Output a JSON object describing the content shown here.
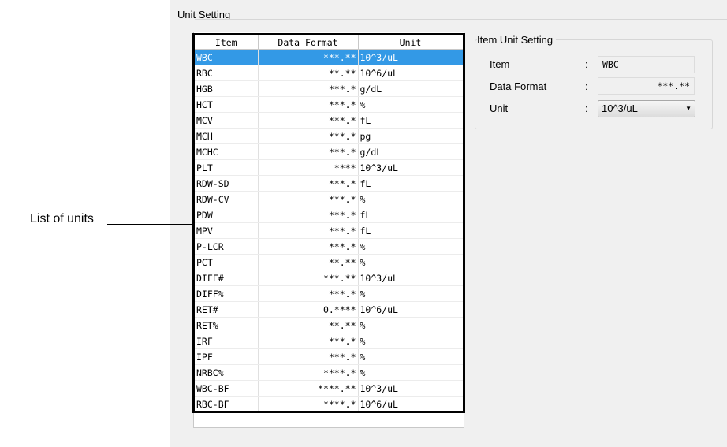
{
  "window": {
    "title": "Unit Setting"
  },
  "annotation": {
    "label": "List of units"
  },
  "list": {
    "columns": [
      "Item",
      "Data Format",
      "Unit"
    ],
    "rows": [
      [
        "WBC",
        "***.**",
        "10^3/uL"
      ],
      [
        "RBC",
        "**.**",
        "10^6/uL"
      ],
      [
        "HGB",
        "***.*",
        "g/dL"
      ],
      [
        "HCT",
        "***.*",
        "%"
      ],
      [
        "MCV",
        "***.*",
        "fL"
      ],
      [
        "MCH",
        "***.*",
        "pg"
      ],
      [
        "MCHC",
        "***.*",
        "g/dL"
      ],
      [
        "PLT",
        "****",
        "10^3/uL"
      ],
      [
        "RDW-SD",
        "***.*",
        "fL"
      ],
      [
        "RDW-CV",
        "***.*",
        "%"
      ],
      [
        "PDW",
        "***.*",
        "fL"
      ],
      [
        "MPV",
        "***.*",
        "fL"
      ],
      [
        "P-LCR",
        "***.*",
        "%"
      ],
      [
        "PCT",
        "**.**",
        "%"
      ],
      [
        "DIFF#",
        "***.**",
        "10^3/uL"
      ],
      [
        "DIFF%",
        "***.*",
        "%"
      ],
      [
        "RET#",
        "0.****",
        "10^6/uL"
      ],
      [
        "RET%",
        "**.**",
        "%"
      ],
      [
        "IRF",
        "***.*",
        "%"
      ],
      [
        "IPF",
        "***.*",
        "%"
      ],
      [
        "NRBC%",
        "****.*",
        "%"
      ],
      [
        "WBC-BF",
        "****.**",
        "10^3/uL"
      ],
      [
        "RBC-BF",
        "****.*",
        "10^6/uL"
      ]
    ],
    "selected_index": 0
  },
  "item_unit_setting": {
    "title": "Item Unit Setting",
    "item_label": "Item",
    "item_value": "WBC",
    "format_label": "Data Format",
    "format_value": "***.**",
    "unit_label": "Unit",
    "unit_value": "10^3/uL",
    "colon": ":"
  }
}
